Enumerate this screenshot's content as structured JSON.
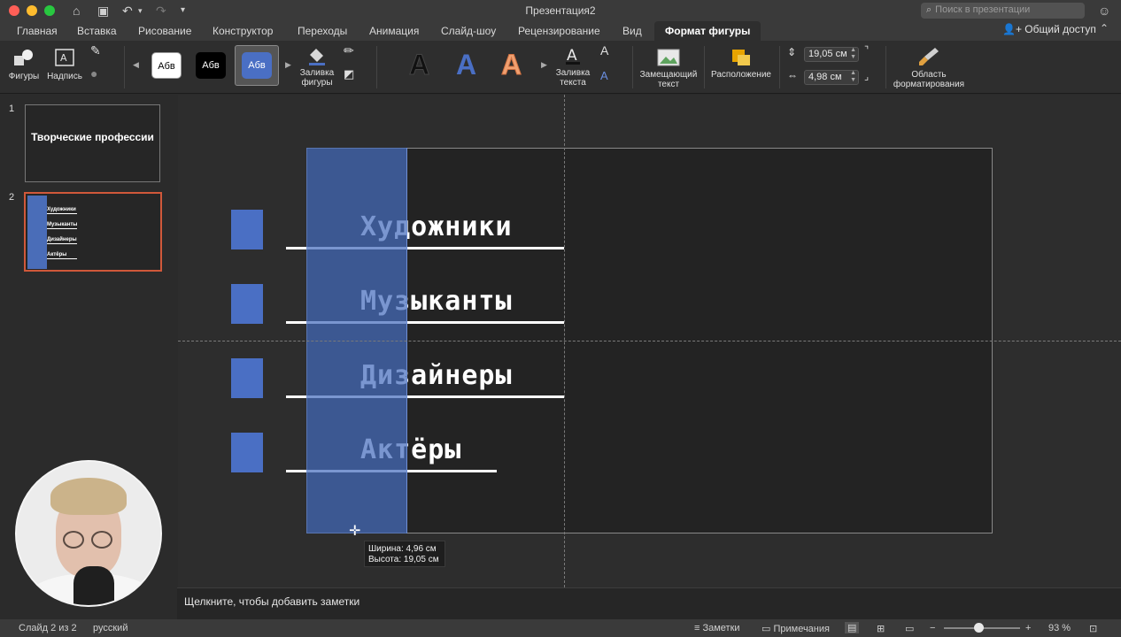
{
  "window": {
    "title": "Презентация2",
    "search_placeholder": "Поиск в презентации"
  },
  "tabs": [
    {
      "label": "Главная"
    },
    {
      "label": "Вставка"
    },
    {
      "label": "Рисование"
    },
    {
      "label": "Конструктор"
    },
    {
      "label": "Переходы"
    },
    {
      "label": "Анимация"
    },
    {
      "label": "Слайд-шоу"
    },
    {
      "label": "Рецензирование"
    },
    {
      "label": "Вид"
    },
    {
      "label": "Формат фигуры",
      "active": true
    }
  ],
  "share_label": "Общий доступ",
  "ribbon": {
    "shapes_label": "Фигуры",
    "textbox_label": "Надпись",
    "style_samples": [
      "Абв",
      "Абв",
      "Абв"
    ],
    "fill_label": "Заливка фигуры",
    "wordart_letters": [
      "A",
      "A",
      "A"
    ],
    "text_fill_label": "Заливка текста",
    "alt_text_label": "Замещающий текст",
    "arrange_label": "Расположение",
    "height_value": "19,05 см",
    "width_value": "4,98 см",
    "format_pane_label": "Область форматирования",
    "accent_color": "#4a6fc4"
  },
  "slides_panel": {
    "slide1": {
      "number": "1",
      "title": "Творческие профессии"
    },
    "slide2": {
      "number": "2",
      "items": [
        "Художники",
        "Музыканты",
        "Дизайнеры",
        "Актёры"
      ]
    }
  },
  "slide": {
    "items": [
      {
        "text": "Художники"
      },
      {
        "text": "Музыканты"
      },
      {
        "text": "Дизайнеры"
      },
      {
        "text": "Актёры"
      }
    ],
    "tooltip_width": "Ширина: 4,96 см",
    "tooltip_height": "Высота: 19,05 см"
  },
  "notes_placeholder": "Щелкните, чтобы добавить заметки",
  "status": {
    "slide_info": "Слайд 2 из 2",
    "language": "русский",
    "notes_label": "Заметки",
    "comments_label": "Примечания",
    "zoom": "93 %"
  }
}
